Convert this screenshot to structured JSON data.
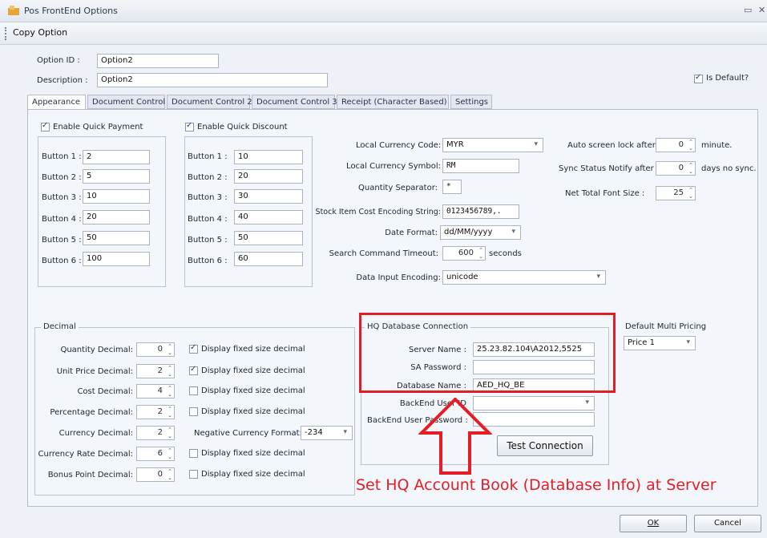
{
  "window": {
    "title": "Pos FrontEnd Options",
    "min": "▭",
    "close": "✕"
  },
  "toolbar": {
    "copy_option": "Copy Option"
  },
  "header": {
    "option_id_label": "Option ID :",
    "option_id": "Option2",
    "description_label": "Description :",
    "description": "Option2",
    "is_default_label": "Is Default?",
    "is_default": true
  },
  "tabs": [
    "Appearance",
    "Document Control",
    "Document Control 2",
    "Document Control 3",
    "Receipt (Character Based)",
    "Settings"
  ],
  "quick_payment": {
    "label": "Enable Quick Payment",
    "checked": true,
    "buttons": [
      {
        "label": "Button 1 :",
        "value": "2"
      },
      {
        "label": "Button 2 :",
        "value": "5"
      },
      {
        "label": "Button 3 :",
        "value": "10"
      },
      {
        "label": "Button 4 :",
        "value": "20"
      },
      {
        "label": "Button 5 :",
        "value": "50"
      },
      {
        "label": "Button 6 :",
        "value": "100"
      }
    ]
  },
  "quick_discount": {
    "label": "Enable Quick Discount",
    "checked": true,
    "buttons": [
      {
        "label": "Button 1 :",
        "value": "10"
      },
      {
        "label": "Button 2 :",
        "value": "20"
      },
      {
        "label": "Button 3 :",
        "value": "30"
      },
      {
        "label": "Button 4 :",
        "value": "40"
      },
      {
        "label": "Button 5 :",
        "value": "50"
      },
      {
        "label": "Button 6 :",
        "value": "60"
      }
    ]
  },
  "currency": {
    "code_label": "Local Currency Code:",
    "code": "MYR",
    "symbol_label": "Local Currency Symbol:",
    "symbol": "RM",
    "qty_sep_label": "Quantity Separator:",
    "qty_sep": "*",
    "encoding_string_label": "Stock Item Cost Encoding String:",
    "encoding_string": "0123456789,.",
    "date_format_label": "Date Format:",
    "date_format": "dd/MM/yyyy",
    "search_timeout_label": "Search Command Timeout:",
    "search_timeout": "600",
    "seconds": "seconds",
    "data_input_label": "Data Input Encoding:",
    "data_input": "unicode"
  },
  "right_opts": {
    "autolock_label": "Auto screen lock after",
    "autolock": "0",
    "minute": "minute.",
    "sync_label": "Sync Status Notify after",
    "sync": "0",
    "days": "days no sync.",
    "font_label": "Net Total Font Size :",
    "font": "25"
  },
  "decimal": {
    "title": "Decimal",
    "rows": [
      {
        "label": "Quantity Decimal:",
        "value": "0",
        "fixed": true
      },
      {
        "label": "Unit Price Decimal:",
        "value": "2",
        "fixed": true
      },
      {
        "label": "Cost Decimal:",
        "value": "4",
        "fixed": false
      },
      {
        "label": "Percentage Decimal:",
        "value": "2",
        "fixed": false
      },
      {
        "label": "Currency Decimal:",
        "value": "2"
      },
      {
        "label": "Currency Rate Decimal:",
        "value": "6",
        "fixed": false
      },
      {
        "label": "Bonus Point Decimal:",
        "value": "0",
        "fixed": false
      }
    ],
    "fixed_label": "Display fixed size decimal",
    "neg_label": "Negative Currency Format:",
    "neg_value": "-234"
  },
  "hq": {
    "title": "HQ Database Connection",
    "server_label": "Server Name :",
    "server": "25.23.82.104\\A2012,5525",
    "sa_label": "SA Password :",
    "sa": "",
    "db_label": "Database Name :",
    "db": "AED_HQ_BE",
    "user_label": "BackEnd User ID",
    "user": "",
    "pwd_label": "BackEnd User Password :",
    "pwd": "",
    "test": "Test Connection"
  },
  "multi_pricing": {
    "label": "Default Multi Pricing",
    "value": "Price 1"
  },
  "annotation": {
    "text": "Set HQ Account Book (Database Info) at Server",
    "color": "#e41e26"
  },
  "footer": {
    "ok": "OK",
    "cancel": "Cancel"
  }
}
